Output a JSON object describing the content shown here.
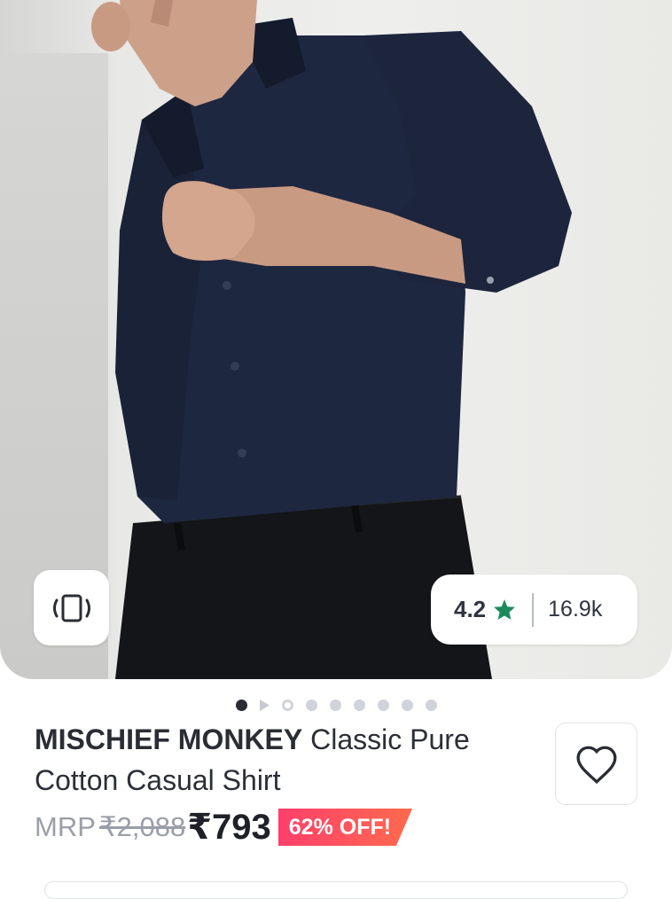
{
  "rating": {
    "value": "4.2",
    "count": "16.9k",
    "star_color": "#1b8a5a"
  },
  "carousel": {
    "total_items": 9,
    "active_index": 0,
    "video_index": 1
  },
  "product": {
    "brand": "MISCHIEF MONKEY",
    "name": "Classic Pure Cotton Casual Shirt"
  },
  "price": {
    "mrp_label": "MRP",
    "mrp": "₹2,088",
    "sale": "₹793",
    "discount": "62% OFF!"
  },
  "icons": {
    "view_in_3d": "rotate-device-icon",
    "wishlist": "heart-icon",
    "rating": "star-icon",
    "video": "play-icon"
  },
  "colors": {
    "accent": "#ff3f6c",
    "shirt": "#1c2438"
  }
}
